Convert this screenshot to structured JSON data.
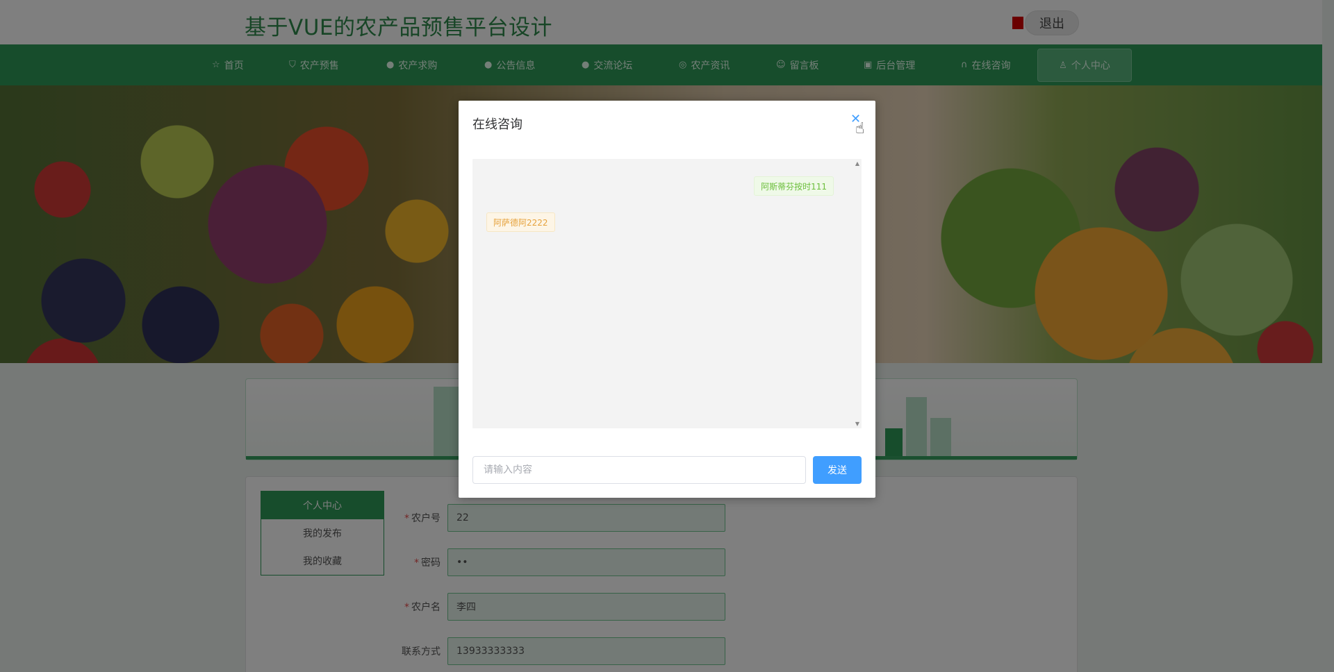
{
  "header": {
    "title": "基于VUE的农产品预售平台设计",
    "logout_label": "退出",
    "user_color": "#d40000"
  },
  "nav": {
    "items": [
      {
        "label": "首页",
        "icon": "star-icon",
        "glyph": "☆"
      },
      {
        "label": "农产预售",
        "icon": "bag-icon",
        "glyph": "⛉"
      },
      {
        "label": "农产求购",
        "icon": "info-icon",
        "glyph": "●"
      },
      {
        "label": "公告信息",
        "icon": "info-icon",
        "glyph": "●"
      },
      {
        "label": "交流论坛",
        "icon": "info-icon",
        "glyph": "●"
      },
      {
        "label": "农产资讯",
        "icon": "globe-icon",
        "glyph": "◎"
      },
      {
        "label": "留言板",
        "icon": "message-icon",
        "glyph": "☺"
      },
      {
        "label": "后台管理",
        "icon": "briefcase-icon",
        "glyph": "▣"
      },
      {
        "label": "在线咨询",
        "icon": "headset-icon",
        "glyph": "∩"
      },
      {
        "label": "个人中心",
        "icon": "user-icon",
        "glyph": "♙"
      }
    ],
    "active_index": 9
  },
  "side_menu": {
    "items": [
      "个人中心",
      "我的发布",
      "我的收藏"
    ],
    "active_index": 0
  },
  "form": {
    "fields": [
      {
        "label": "农户号",
        "value": "22",
        "required": true
      },
      {
        "label": "密码",
        "value": "••",
        "required": true
      },
      {
        "label": "农户名",
        "value": "李四",
        "required": true
      },
      {
        "label": "联系方式",
        "value": "13933333333",
        "required": false
      }
    ]
  },
  "dialog": {
    "title": "在线咨询",
    "close_icon": "close-icon",
    "messages": [
      {
        "side": "right",
        "text": "阿斯蒂芬按时111"
      },
      {
        "side": "left",
        "text": "阿萨德阿2222"
      }
    ],
    "input_placeholder": "请输入内容",
    "send_label": "发送"
  },
  "colors": {
    "primary_green": "#2e9a58",
    "send_blue": "#409eff"
  }
}
